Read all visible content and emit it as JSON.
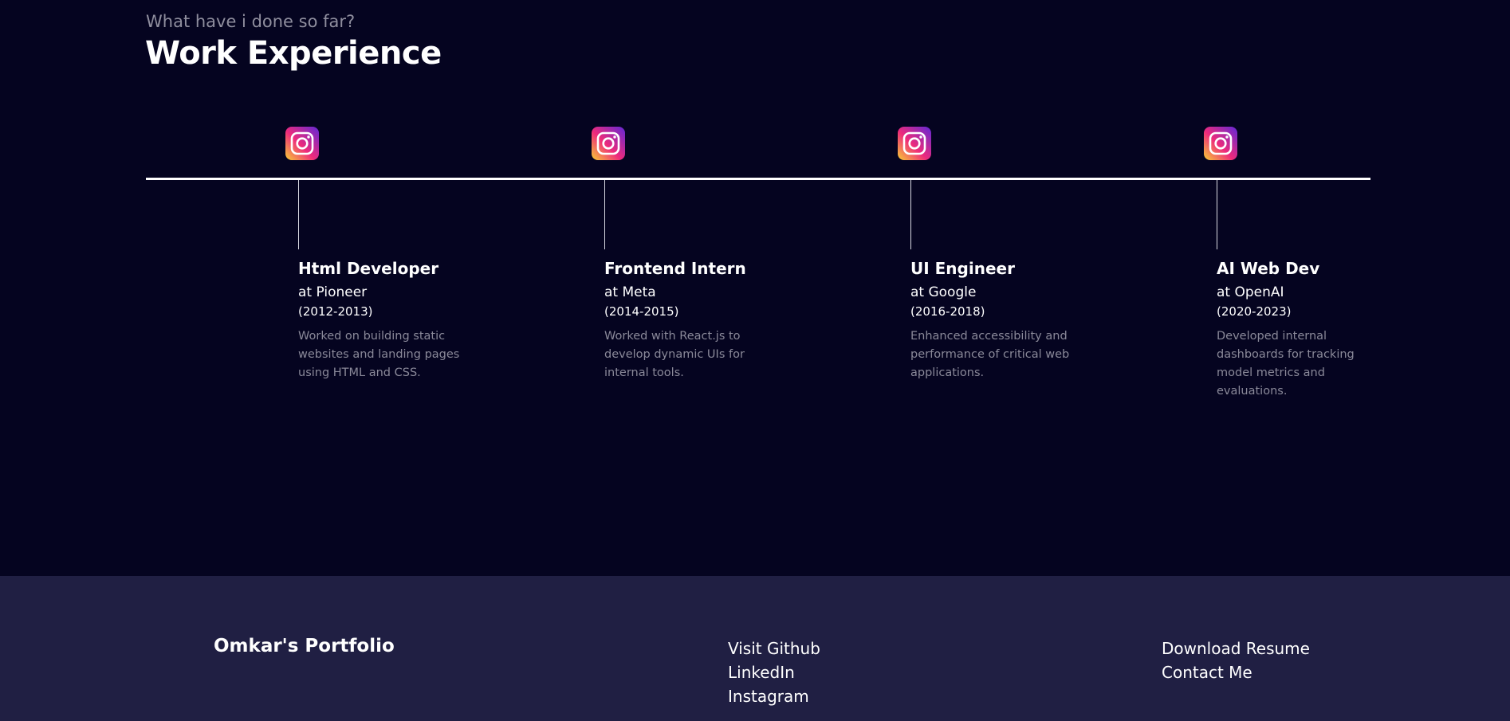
{
  "section": {
    "subtitle": "What have i done so far?",
    "title": "Work Experience"
  },
  "experiences": [
    {
      "logo_icon": "instagram-icon",
      "role": "Html Developer",
      "company": "at Pioneer",
      "period": "(2012-2013)",
      "description": "Worked on building static websites and landing pages using HTML and CSS."
    },
    {
      "logo_icon": "instagram-icon",
      "role": "Frontend Intern",
      "company": "at Meta",
      "period": "(2014-2015)",
      "description": "Worked with React.js to develop dynamic UIs for internal tools."
    },
    {
      "logo_icon": "instagram-icon",
      "role": "UI Engineer",
      "company": "at Google",
      "period": "(2016-2018)",
      "description": "Enhanced accessibility and performance of critical web applications."
    },
    {
      "logo_icon": "instagram-icon",
      "role": "AI Web Dev",
      "company": "at OpenAI",
      "period": "(2020-2023)",
      "description": "Developed internal dashboards for tracking model metrics and evaluations."
    }
  ],
  "footer": {
    "brand": "Omkar's Portfolio",
    "links_col1": [
      "Visit Github",
      "LinkedIn",
      "Instagram"
    ],
    "links_col2": [
      "Download Resume",
      "Contact Me"
    ]
  },
  "colors": {
    "background": "#050420",
    "footer_background": "#201f43",
    "text_primary": "#ffffff",
    "text_muted": "#8a8999"
  }
}
